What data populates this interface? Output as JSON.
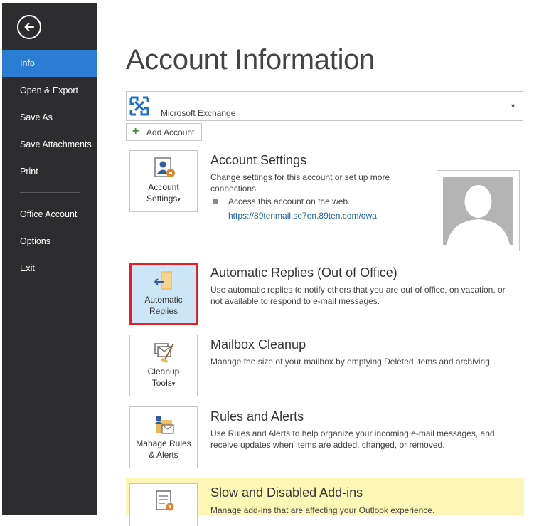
{
  "sidebar": {
    "back_label": "Back",
    "items": [
      {
        "label": "Info",
        "active": true
      },
      {
        "label": "Open & Export"
      },
      {
        "label": "Save As"
      },
      {
        "label": "Save Attachments"
      },
      {
        "label": "Print"
      },
      {
        "label": "Office Account"
      },
      {
        "label": "Options"
      },
      {
        "label": "Exit"
      }
    ]
  },
  "main": {
    "title": "Account Information",
    "account_selector": {
      "label": "Microsoft Exchange",
      "icon": "exchange-icon"
    },
    "add_account_label": "Add Account",
    "sections": {
      "account_settings": {
        "tile_line1": "Account",
        "tile_line2": "Settings",
        "tile_caret": "▾",
        "title": "Account Settings",
        "description": "Change settings for this account or set up more connections.",
        "bullet": "Access this account on the web.",
        "link": "https://89tenmail.se7en.89ten.com/owa"
      },
      "automatic_replies": {
        "tile_line1": "Automatic",
        "tile_line2": "Replies",
        "title": "Automatic Replies (Out of Office)",
        "description": "Use automatic replies to notify others that you are out of office, on vacation, or not available to respond to e-mail messages."
      },
      "mailbox_cleanup": {
        "tile_line1": "Cleanup",
        "tile_line2": "Tools",
        "tile_caret": "▾",
        "title": "Mailbox Cleanup",
        "description": "Manage the size of your mailbox by emptying Deleted Items and archiving."
      },
      "rules_alerts": {
        "tile_line1": "Manage Rules",
        "tile_line2": "& Alerts",
        "title": "Rules and Alerts",
        "description": "Use Rules and Alerts to help organize your incoming e-mail messages, and receive updates when items are added, changed, or removed."
      },
      "addins": {
        "title": "Slow and Disabled Add-ins",
        "description": "Manage add-ins that are affecting your Outlook experience."
      }
    }
  },
  "colors": {
    "sidebar_bg": "#2d2d30",
    "active_nav": "#2b7cd3",
    "highlight_bg": "#fcf7b6",
    "selected_border": "#e61e27",
    "link": "#1e5fa8"
  }
}
